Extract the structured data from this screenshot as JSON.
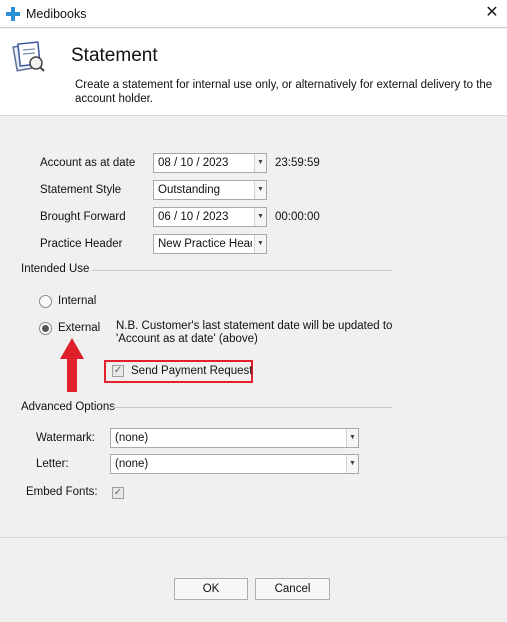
{
  "window": {
    "title": "Medibooks"
  },
  "header": {
    "title": "Statement",
    "description": "Create a statement for internal use only, or alternatively for external delivery to the account holder."
  },
  "fields": {
    "account_as_at": {
      "label": "Account as at date",
      "value": "08 / 10 / 2023",
      "time": "23:59:59"
    },
    "statement_style": {
      "label": "Statement Style",
      "value": "Outstanding"
    },
    "brought_forward": {
      "label": "Brought Forward",
      "value": "06 / 10 / 2023",
      "time": "00:00:00"
    },
    "practice_header": {
      "label": "Practice Header",
      "value": "New Practice Head"
    }
  },
  "intended_use": {
    "title": "Intended Use",
    "internal_label": "Internal",
    "external_label": "External",
    "selected": "External",
    "note": "N.B. Customer's last statement date will be updated to 'Account as at date' (above)",
    "send_payment_label": "Send Payment Request",
    "send_payment_checked": true
  },
  "advanced": {
    "title": "Advanced Options",
    "watermark_label": "Watermark:",
    "watermark_value": "(none)",
    "letter_label": "Letter:",
    "letter_value": "(none)",
    "embed_fonts_label": "Embed Fonts:",
    "embed_fonts_checked": true
  },
  "buttons": {
    "ok": "OK",
    "cancel": "Cancel"
  },
  "colors": {
    "highlight": "#e0202a",
    "arrow": "#e0202a",
    "app_icon": "#2b8fd6"
  }
}
